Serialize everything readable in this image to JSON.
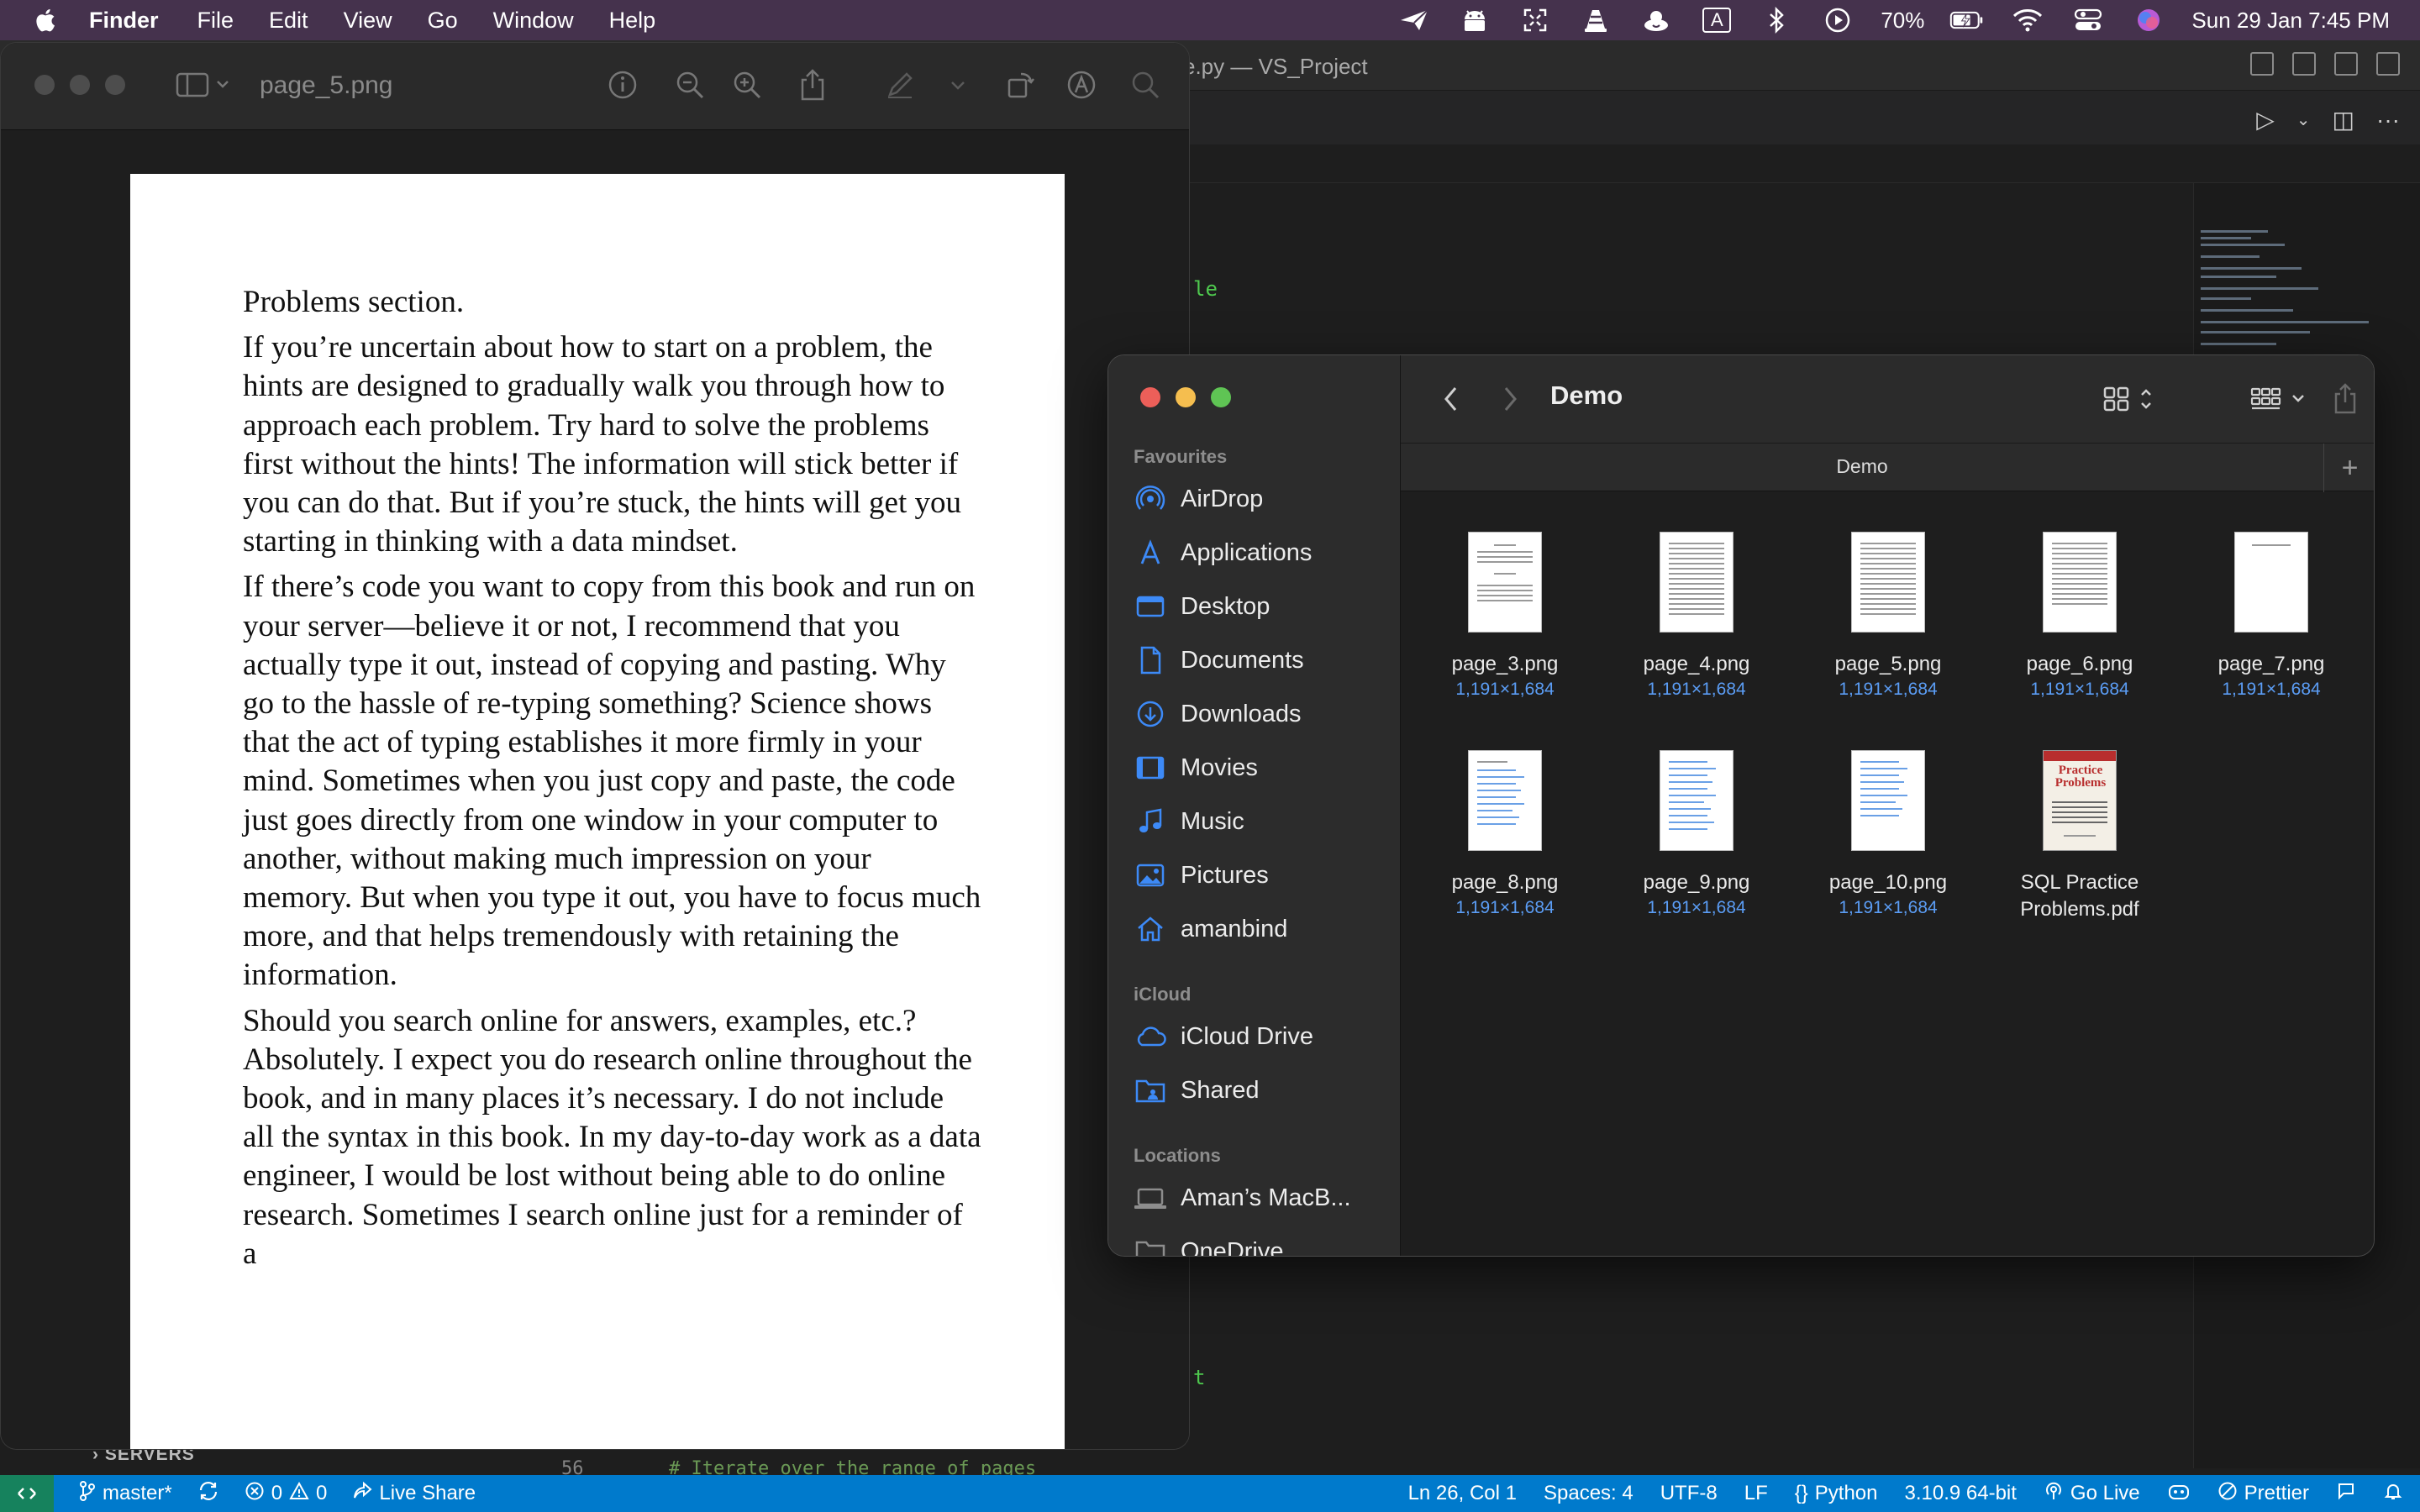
{
  "menubar": {
    "apple_icon": "apple-logo",
    "app_name": "Finder",
    "items": [
      "File",
      "Edit",
      "View",
      "Go",
      "Window",
      "Help"
    ],
    "status_icons": [
      "paper-plane-icon",
      "android-icon",
      "expand-icon",
      "vlc-cone-icon",
      "cloud-icon",
      "input-source-icon",
      "bluetooth-icon",
      "play-circle-icon"
    ],
    "input_source": "A",
    "battery_percent": "70%",
    "datetime": "Sun 29 Jan  7:45 PM"
  },
  "vscode": {
    "window_title": "e.py — VS_Project",
    "code_fragment_1": "le",
    "code_fragment_2": "t",
    "servers_label": "SERVERS",
    "line_number": "56",
    "code_comment": "# Iterate over the range of pages"
  },
  "statusbar": {
    "branch": "master*",
    "errors": "0",
    "warnings": "0",
    "live_share": "Live Share",
    "cursor": "Ln 26, Col 1",
    "spaces": "Spaces: 4",
    "encoding": "UTF-8",
    "eol": "LF",
    "language": "Python",
    "interpreter": "3.10.9 64-bit",
    "go_live": "Go Live",
    "prettier": "Prettier"
  },
  "preview": {
    "title": "page_5.png",
    "paragraphs": [
      "Problems section.",
      "If you’re uncertain about how to start on a problem, the hints are designed to gradually walk you through how to approach each problem. Try hard to solve the problems first without the hints! The information will stick better if you can do that. But if you’re stuck, the hints will get you starting in thinking with a data mindset.",
      "If there’s code you want to copy from this book and run on your server—believe it or not, I recommend that you actually type it out, instead of copying and pasting. Why go to the hassle of re-typing something? Science shows that the act of typing establishes it more firmly in your mind. Sometimes when you just copy and paste, the code just goes directly from one window in your computer to another, without making much impression on your memory. But when you type it out, you have to focus much more, and that helps tremendously with retaining the information.",
      "Should you search online for answers, examples, etc.? Absolutely. I expect you do research online throughout the book, and in many places it’s necessary. I do not include all the syntax in this book. In my day-to-day work as a data engineer, I would be lost without being able to do online research. Sometimes I search online just for a reminder of a"
    ]
  },
  "finder": {
    "title": "Demo",
    "path_label": "Demo",
    "sidebar": {
      "favourites_title": "Favourites",
      "favourites": [
        {
          "label": "AirDrop",
          "icon": "airdrop-icon"
        },
        {
          "label": "Applications",
          "icon": "applications-icon"
        },
        {
          "label": "Desktop",
          "icon": "desktop-icon"
        },
        {
          "label": "Documents",
          "icon": "document-icon"
        },
        {
          "label": "Downloads",
          "icon": "downloads-icon"
        },
        {
          "label": "Movies",
          "icon": "film-icon"
        },
        {
          "label": "Music",
          "icon": "music-note-icon"
        },
        {
          "label": "Pictures",
          "icon": "photo-icon"
        },
        {
          "label": "amanbind",
          "icon": "home-icon"
        }
      ],
      "icloud_title": "iCloud",
      "icloud": [
        {
          "label": "iCloud Drive",
          "icon": "icloud-icon"
        },
        {
          "label": "Shared",
          "icon": "shared-folder-icon"
        }
      ],
      "locations_title": "Locations",
      "locations": [
        {
          "label": "Aman’s MacB...",
          "icon": "laptop-icon"
        },
        {
          "label": "OneDrive",
          "icon": "folder-icon"
        }
      ]
    },
    "files": [
      {
        "name": "page_3.png",
        "dims": "1,191×1,684"
      },
      {
        "name": "page_4.png",
        "dims": "1,191×1,684"
      },
      {
        "name": "page_5.png",
        "dims": "1,191×1,684"
      },
      {
        "name": "page_6.png",
        "dims": "1,191×1,684"
      },
      {
        "name": "page_7.png",
        "dims": "1,191×1,684"
      },
      {
        "name": "page_8.png",
        "dims": "1,191×1,684"
      },
      {
        "name": "page_9.png",
        "dims": "1,191×1,684"
      },
      {
        "name": "page_10.png",
        "dims": "1,191×1,684"
      },
      {
        "name": "SQL Practice Problems.pdf",
        "dims": "",
        "cover_title": "Practice Problems"
      }
    ]
  },
  "colors": {
    "menubar": "#45324d",
    "statusbar": "#007acc",
    "dims_blue": "#5b9df5",
    "traffic_red": "#ec5f59",
    "traffic_yellow": "#f5be4f",
    "traffic_green": "#5fc454"
  }
}
